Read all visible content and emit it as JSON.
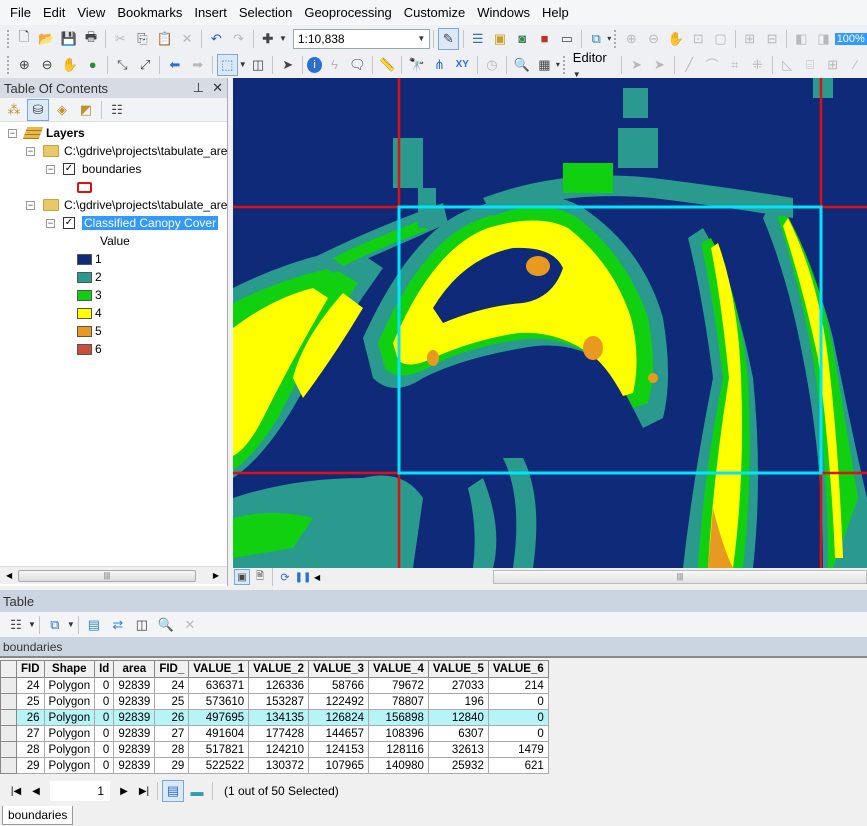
{
  "menu": [
    "File",
    "Edit",
    "View",
    "Bookmarks",
    "Insert",
    "Selection",
    "Geoprocessing",
    "Customize",
    "Windows",
    "Help"
  ],
  "toolbar": {
    "scale_value": "1:10,838",
    "editor_label": "Editor",
    "zoom_percent": "100%"
  },
  "toc": {
    "title": "Table Of Contents",
    "pin_glyph": "⊥",
    "close_glyph": "✕",
    "root": "Layers",
    "groups": [
      {
        "path": "C:\\gdrive\\projects\\tabulate_are",
        "layer": "boundaries",
        "checked": true,
        "symbol_color": "#e01010"
      },
      {
        "path": "C:\\gdrive\\projects\\tabulate_are",
        "layer": "Classified Canopy Cover",
        "checked": true
      }
    ],
    "legend_heading": "Value",
    "legend": [
      {
        "label": "1",
        "color": "#0e2a78"
      },
      {
        "label": "2",
        "color": "#2a9a8e"
      },
      {
        "label": "3",
        "color": "#10d010"
      },
      {
        "label": "4",
        "color": "#ffff00"
      },
      {
        "label": "5",
        "color": "#e89a20"
      },
      {
        "label": "6",
        "color": "#c8503a"
      }
    ]
  },
  "map": {
    "boundary_color": "#e01010",
    "selection_color": "#00e5ff"
  },
  "table": {
    "title": "Table",
    "layer_name": "boundaries",
    "columns": [
      "FID",
      "Shape",
      "Id",
      "area",
      "FID_",
      "VALUE_1",
      "VALUE_2",
      "VALUE_3",
      "VALUE_4",
      "VALUE_5",
      "VALUE_6"
    ],
    "rows": [
      [
        "24",
        "Polygon",
        "0",
        "92839",
        "24",
        "636371",
        "126336",
        "58766",
        "79672",
        "27033",
        "214"
      ],
      [
        "25",
        "Polygon",
        "0",
        "92839",
        "25",
        "573610",
        "153287",
        "122492",
        "78807",
        "196",
        "0"
      ],
      [
        "26",
        "Polygon",
        "0",
        "92839",
        "26",
        "497695",
        "134135",
        "126824",
        "156898",
        "12840",
        "0"
      ],
      [
        "27",
        "Polygon",
        "0",
        "92839",
        "27",
        "491604",
        "177428",
        "144657",
        "108396",
        "6307",
        "0"
      ],
      [
        "28",
        "Polygon",
        "0",
        "92839",
        "28",
        "517821",
        "124210",
        "124153",
        "128116",
        "32613",
        "1479"
      ],
      [
        "29",
        "Polygon",
        "0",
        "92839",
        "29",
        "522522",
        "130372",
        "107965",
        "140980",
        "25932",
        "621"
      ]
    ],
    "selected_row_fid": "26",
    "current_record": "1",
    "status": "(1 out of 50 Selected)",
    "bottom_tab": "boundaries"
  }
}
